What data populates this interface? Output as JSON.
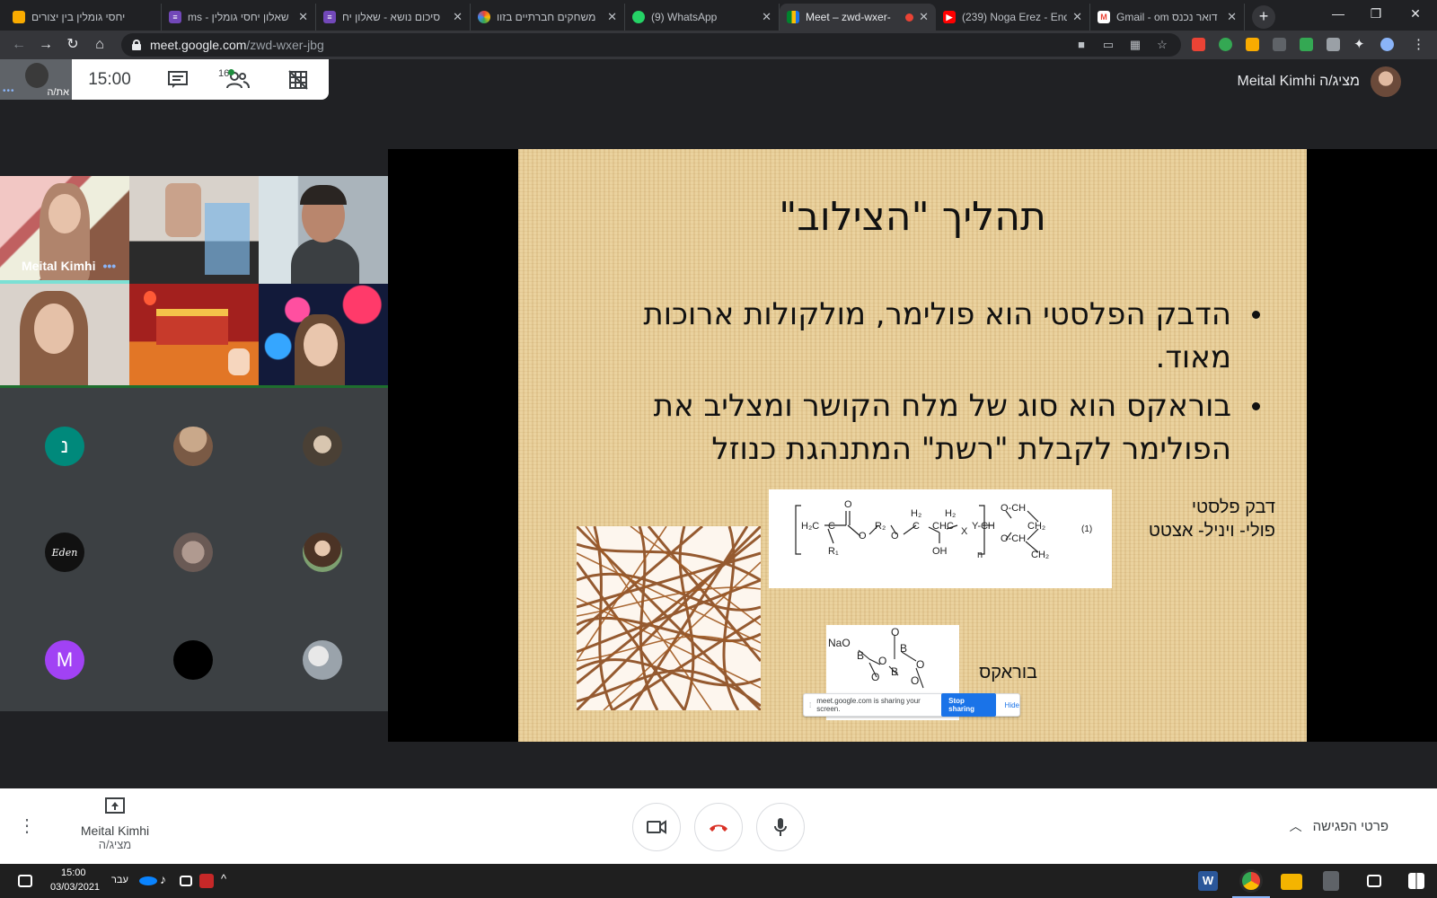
{
  "browser": {
    "tabs": [
      {
        "title": "יחסי גומלין בין יצורים",
        "favicon": "classroom-icon",
        "color": "#f9ab00"
      },
      {
        "title": "שאלון יחסי גומלין - ms",
        "favicon": "forms-icon",
        "color": "#7248b9"
      },
      {
        "title": "סיכום נושא - שאלון יח",
        "favicon": "forms-icon",
        "color": "#7248b9"
      },
      {
        "title": "משחקים חברתיים בזוו",
        "favicon": "colorful-icon",
        "color": "#e8710a"
      },
      {
        "title": "(9) WhatsApp",
        "favicon": "whatsapp-icon",
        "color": "#25d366"
      },
      {
        "title": "Meet – zwd-wxer-",
        "favicon": "meet-icon",
        "color": "#00897b"
      },
      {
        "title": "(239) Noga Erez - End",
        "favicon": "youtube-icon",
        "color": "#ff0000"
      },
      {
        "title": "דואר נכנס Gmail - om",
        "favicon": "gmail-icon",
        "color": "#ea4335"
      }
    ],
    "url_host": "meet.google.com",
    "url_path": "/zwd-wxer-jbg"
  },
  "meet": {
    "self_label": "את/ה",
    "clock": "15:00",
    "participants_count": "16",
    "presenter_line": "Meital Kimhi מציג/ה",
    "participants": [
      {
        "name": "Meital Kimhi"
      },
      {
        "initial": "נ",
        "color": "#00897b"
      },
      {
        "initial": "Eden",
        "color": "#111111"
      },
      {
        "initial": "M",
        "color": "#a142f4"
      }
    ],
    "bottom": {
      "presenter_name": "Meital Kimhi",
      "presenter_role": "מציג/ה",
      "meeting_details": "פרטי הפגישה"
    }
  },
  "slide": {
    "title": "תהליך \"הצילוב\"",
    "bullets": [
      "הדבק הפלסטי הוא פולימר, מולקולות ארוכות מאוד.",
      "בוראקס הוא סוג של מלח הקושר ומצליב את הפולימר לקבלת \"רשת\" המתנהגת כנוזל"
    ],
    "glue_label_1": "דבק פלסטי",
    "glue_label_2": "פולי- ויניל- אצטט",
    "borax_label": "בוראקס",
    "formula_marker": "(1)",
    "share_notice": "meet.google.com is sharing your screen.",
    "stop_sharing": "Stop sharing",
    "hide": "Hide"
  },
  "taskbar": {
    "time": "15:00",
    "date": "03/03/2021",
    "lang": "עבר"
  }
}
